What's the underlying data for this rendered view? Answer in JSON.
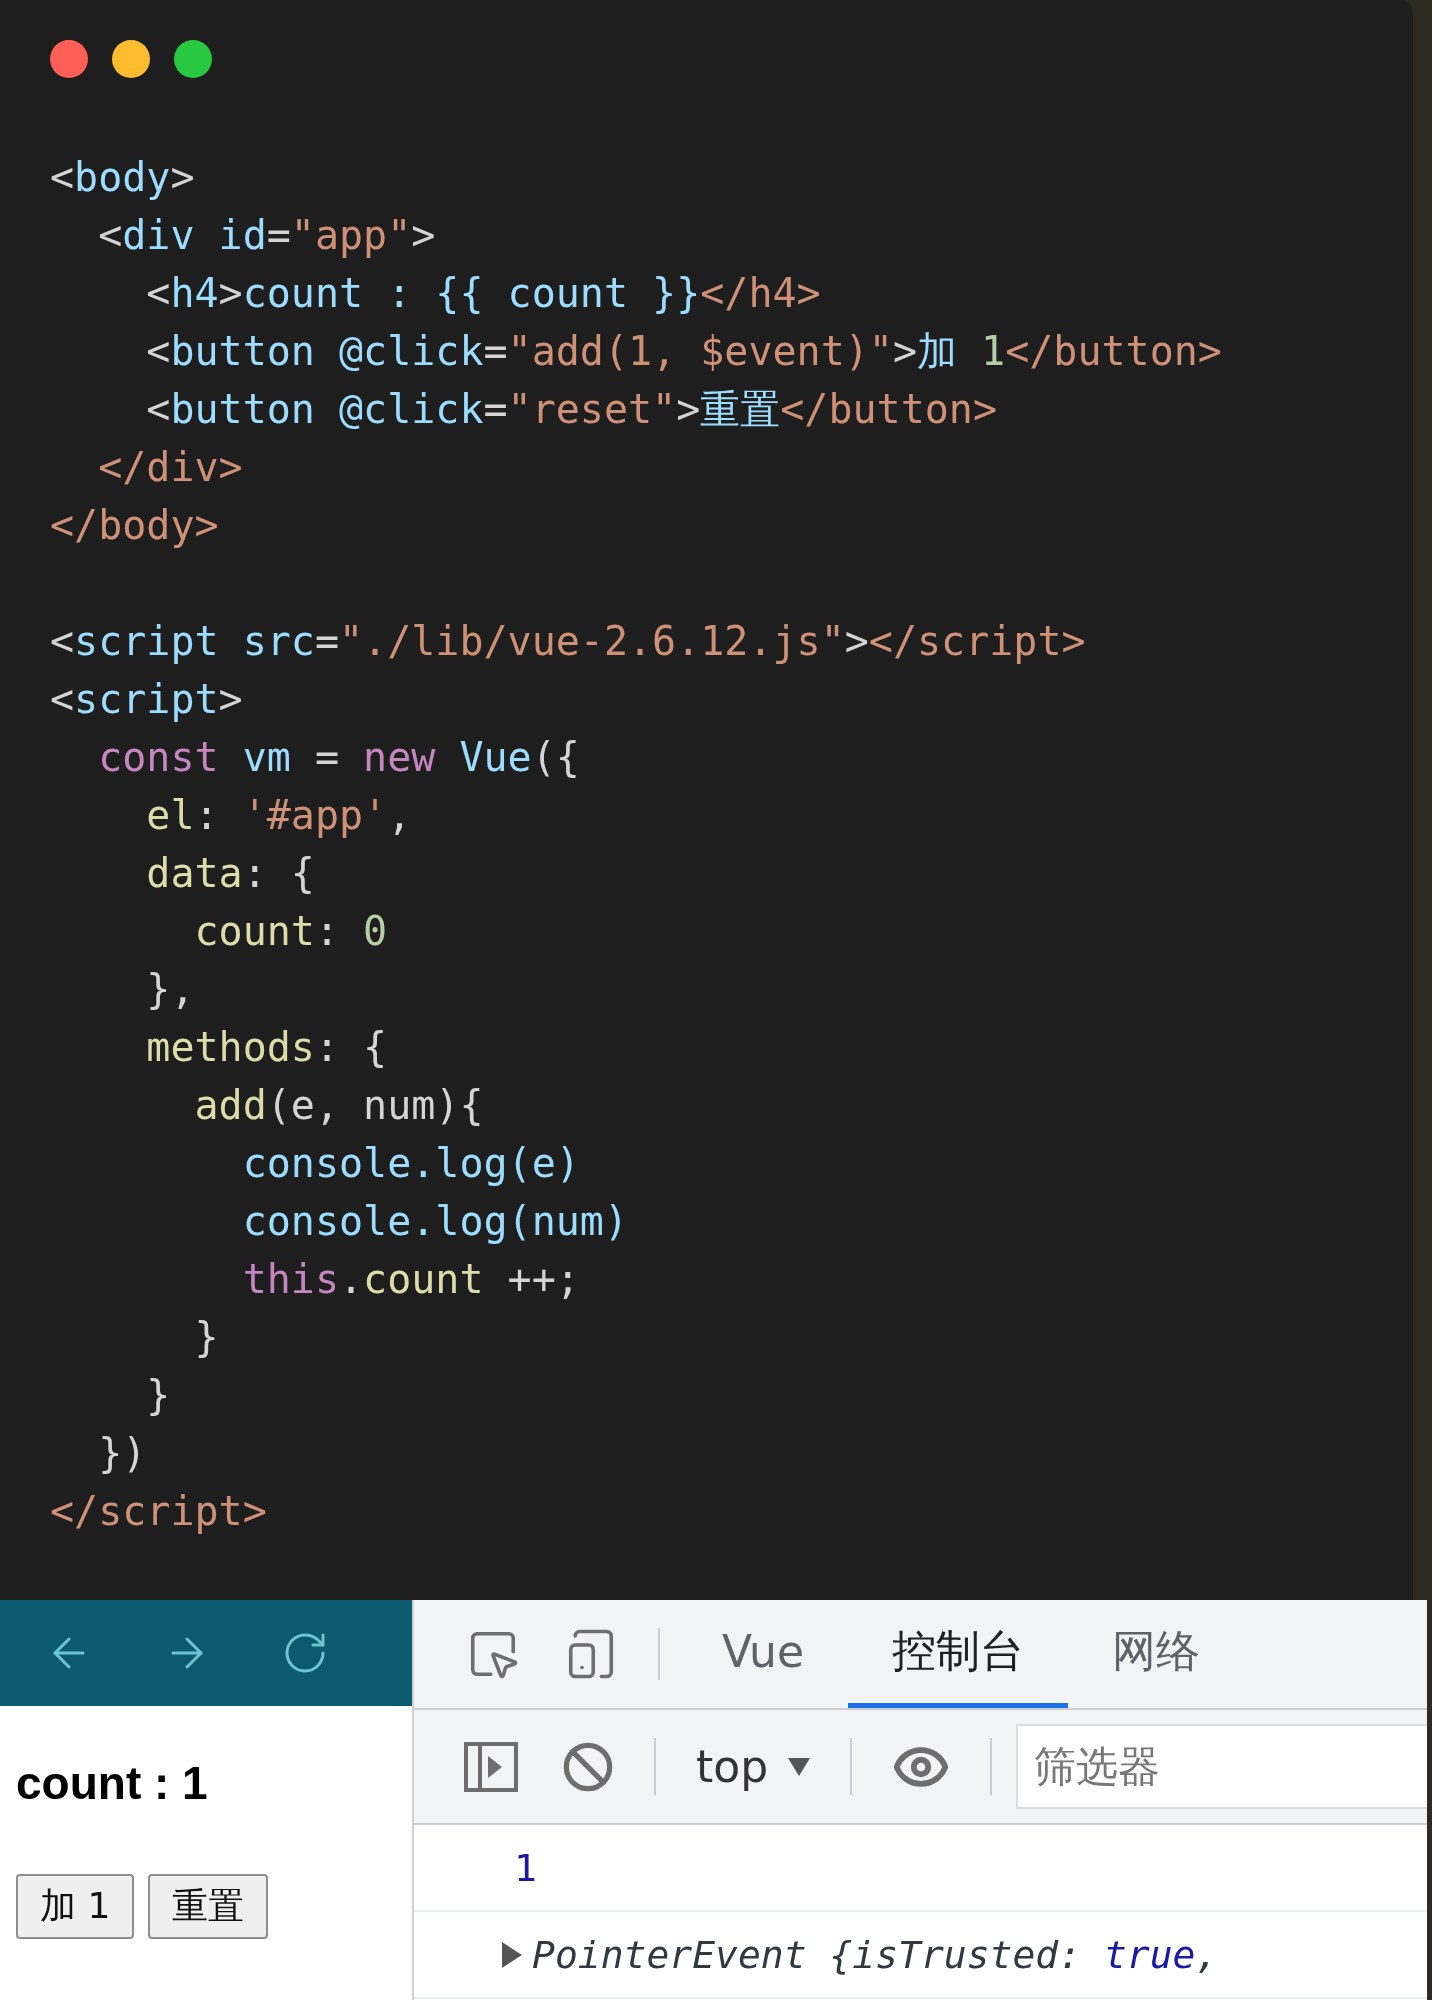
{
  "editor": {
    "blocks": [
      {
        "lines": [
          {
            "tokens": [
              {
                "kind": "punct",
                "text": "<"
              },
              {
                "kind": "tag",
                "text": "body"
              },
              {
                "kind": "punct",
                "text": ">"
              }
            ]
          },
          {
            "tokens": [
              {
                "kind": "punct",
                "text": "  <"
              },
              {
                "kind": "tag",
                "text": "div"
              },
              {
                "kind": "attr",
                "text": " id"
              },
              {
                "kind": "punct",
                "text": "="
              },
              {
                "kind": "string",
                "text": "\"app\""
              },
              {
                "kind": "punct",
                "text": ">"
              }
            ]
          },
          {
            "tokens": [
              {
                "kind": "punct",
                "text": "    <"
              },
              {
                "kind": "tag",
                "text": "h4"
              },
              {
                "kind": "punct",
                "text": ">"
              },
              {
                "kind": "text",
                "text": "count : {{ count }}"
              },
              {
                "kind": "closetag",
                "text": "</h4>"
              }
            ]
          },
          {
            "tokens": [
              {
                "kind": "punct",
                "text": "    <"
              },
              {
                "kind": "tag",
                "text": "button"
              },
              {
                "kind": "attr",
                "text": " @click"
              },
              {
                "kind": "punct",
                "text": "="
              },
              {
                "kind": "string",
                "text": "\"add(1, $event)\""
              },
              {
                "kind": "punct",
                "text": ">"
              },
              {
                "kind": "text",
                "text": "加 "
              },
              {
                "kind": "number",
                "text": "1"
              },
              {
                "kind": "closetag",
                "text": "</button>"
              }
            ]
          },
          {
            "tokens": [
              {
                "kind": "punct",
                "text": "    <"
              },
              {
                "kind": "tag",
                "text": "button"
              },
              {
                "kind": "attr",
                "text": " @click"
              },
              {
                "kind": "punct",
                "text": "="
              },
              {
                "kind": "string",
                "text": "\"reset\""
              },
              {
                "kind": "punct",
                "text": ">"
              },
              {
                "kind": "text",
                "text": "重置"
              },
              {
                "kind": "closetag",
                "text": "</button>"
              }
            ]
          },
          {
            "tokens": [
              {
                "kind": "closetag",
                "text": "  </div>"
              }
            ]
          },
          {
            "tokens": [
              {
                "kind": "closetag",
                "text": "</body>"
              }
            ]
          }
        ]
      },
      {
        "lines": [
          {
            "tokens": [
              {
                "kind": "punct",
                "text": "<"
              },
              {
                "kind": "tag",
                "text": "script"
              },
              {
                "kind": "attr",
                "text": " src"
              },
              {
                "kind": "punct",
                "text": "="
              },
              {
                "kind": "string",
                "text": "\"./lib/vue-2.6.12.js\""
              },
              {
                "kind": "punct",
                "text": ">"
              },
              {
                "kind": "closetag",
                "text": "</script>"
              }
            ]
          },
          {
            "tokens": [
              {
                "kind": "punct",
                "text": "<"
              },
              {
                "kind": "tag",
                "text": "script"
              },
              {
                "kind": "punct",
                "text": ">"
              }
            ]
          },
          {
            "tokens": [
              {
                "kind": "keyword",
                "text": "  const"
              },
              {
                "kind": "ident",
                "text": " vm"
              },
              {
                "kind": "punct",
                "text": " = "
              },
              {
                "kind": "keyword",
                "text": "new"
              },
              {
                "kind": "ident",
                "text": " Vue"
              },
              {
                "kind": "punct",
                "text": "({"
              }
            ]
          },
          {
            "tokens": [
              {
                "kind": "prop",
                "text": "    el"
              },
              {
                "kind": "punct",
                "text": ": "
              },
              {
                "kind": "string",
                "text": "'#app'"
              },
              {
                "kind": "punct",
                "text": ","
              }
            ]
          },
          {
            "tokens": [
              {
                "kind": "prop",
                "text": "    data"
              },
              {
                "kind": "punct",
                "text": ": {"
              }
            ]
          },
          {
            "tokens": [
              {
                "kind": "prop",
                "text": "      count"
              },
              {
                "kind": "punct",
                "text": ": "
              },
              {
                "kind": "number",
                "text": "0"
              }
            ]
          },
          {
            "tokens": [
              {
                "kind": "punct",
                "text": "    },"
              }
            ]
          },
          {
            "tokens": [
              {
                "kind": "prop",
                "text": "    methods"
              },
              {
                "kind": "punct",
                "text": ": {"
              }
            ]
          },
          {
            "tokens": [
              {
                "kind": "prop",
                "text": "      add"
              },
              {
                "kind": "punct",
                "text": "(e, num){"
              }
            ]
          },
          {
            "tokens": [
              {
                "kind": "ident",
                "text": "        console.log(e)"
              }
            ]
          },
          {
            "tokens": [
              {
                "kind": "ident",
                "text": "        console.log(num)"
              }
            ]
          },
          {
            "tokens": [
              {
                "kind": "keyword",
                "text": "        this"
              },
              {
                "kind": "punct",
                "text": "."
              },
              {
                "kind": "prop",
                "text": "count"
              },
              {
                "kind": "punct",
                "text": " ++;"
              }
            ]
          },
          {
            "tokens": [
              {
                "kind": "punct",
                "text": "      }"
              }
            ]
          },
          {
            "tokens": [
              {
                "kind": "punct",
                "text": "    }"
              }
            ]
          },
          {
            "tokens": [
              {
                "kind": "punct",
                "text": "  })"
              }
            ]
          },
          {
            "tokens": [
              {
                "kind": "closetag",
                "text": "</script>"
              }
            ]
          }
        ]
      }
    ]
  },
  "browser": {
    "heading": "count : 1",
    "buttons": [
      "加 1",
      "重置"
    ]
  },
  "devtools": {
    "tabs": [
      {
        "label": "Vue",
        "selected": false
      },
      {
        "label": "控制台",
        "selected": true
      },
      {
        "label": "网络",
        "selected": false
      }
    ],
    "context": "top",
    "filter": {
      "placeholder": "筛选器"
    },
    "console": [
      {
        "kind": "value",
        "tokens": [
          {
            "kind": "number",
            "text": "1"
          }
        ]
      },
      {
        "kind": "object",
        "tokens": [
          {
            "kind": "name",
            "text": "PointerEvent {isTrusted: "
          },
          {
            "kind": "boolean",
            "text": "true"
          },
          {
            "kind": "name",
            "text": ","
          }
        ]
      }
    ]
  }
}
